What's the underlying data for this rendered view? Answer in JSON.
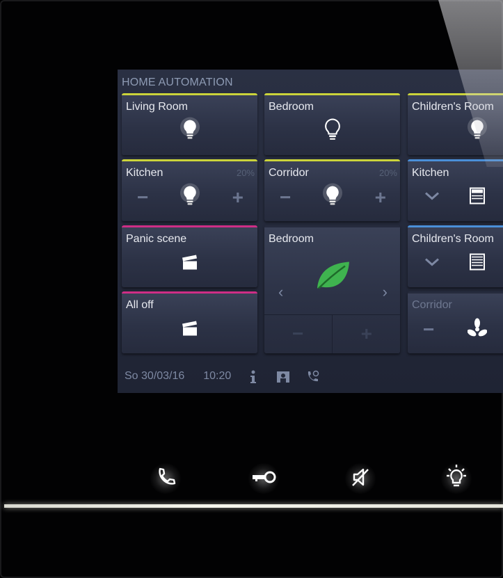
{
  "screen": {
    "title": "HOME AUTOMATION"
  },
  "tiles": {
    "living_room": {
      "label": "Living Room",
      "icon": "bulb-on-icon",
      "accent": "#cbd43a"
    },
    "bedroom": {
      "label": "Bedroom",
      "icon": "bulb-off-icon",
      "accent": "#cbd43a"
    },
    "childrens_room_light": {
      "label": "Children's Room",
      "icon": "bulb-on-icon",
      "accent": "#cbd43a"
    },
    "kitchen_dimmer": {
      "label": "Kitchen",
      "percent": "20%",
      "icon": "bulb-on-icon",
      "accent": "#cbd43a"
    },
    "corridor_dimmer": {
      "label": "Corridor",
      "percent": "20%",
      "icon": "bulb-on-icon",
      "accent": "#cbd43a"
    },
    "kitchen_blind": {
      "label": "Kitchen",
      "icon": "blind-icon",
      "accent": "#4a8fd8"
    },
    "panic_scene": {
      "label": "Panic scene",
      "icon": "scene-clapper-icon",
      "accent": "#cf2e86"
    },
    "bedroom_climate": {
      "label": "Bedroom",
      "icon": "leaf-icon",
      "accent": "#3fb34f"
    },
    "childrens_room_blind": {
      "label": "Children's Room",
      "icon": "blind-icon",
      "accent": "#4a8fd8"
    },
    "all_off": {
      "label": "All off",
      "icon": "scene-clapper-icon",
      "accent": "#cf2e86"
    },
    "corridor_fan": {
      "label": "Corridor",
      "icon": "fan-icon"
    }
  },
  "status": {
    "date": "So 30/03/16",
    "time": "10:20"
  },
  "hardware_buttons": [
    {
      "name": "call",
      "icon": "phone-icon"
    },
    {
      "name": "door-open",
      "icon": "key-icon"
    },
    {
      "name": "mute",
      "icon": "mute-icon"
    },
    {
      "name": "light",
      "icon": "light-icon"
    }
  ]
}
